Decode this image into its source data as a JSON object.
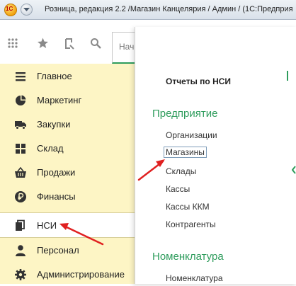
{
  "window": {
    "title": "Розница, редакция 2.2 /Магазин Канцелярия / Админ /  (1С:Предприя"
  },
  "tabs": [
    {
      "label": "Нач"
    }
  ],
  "sidebar": {
    "items": [
      {
        "label": "Главное",
        "icon": "menu-lines-icon"
      },
      {
        "label": "Маркетинг",
        "icon": "pie-chart-icon"
      },
      {
        "label": "Закупки",
        "icon": "truck-icon"
      },
      {
        "label": "Склад",
        "icon": "warehouse-grid-icon"
      },
      {
        "label": "Продажи",
        "icon": "basket-icon"
      },
      {
        "label": "Финансы",
        "icon": "ruble-coin-icon"
      },
      {
        "label": "НСИ",
        "icon": "documents-icon",
        "active": true
      },
      {
        "label": "Персонал",
        "icon": "person-icon"
      },
      {
        "label": "Администрирование",
        "icon": "gear-icon"
      }
    ]
  },
  "panel": {
    "reports_heading": "Отчеты по НСИ",
    "section1": {
      "title": "Предприятие",
      "links": [
        "Организации",
        "Магазины",
        "Склады",
        "Кассы",
        "Кассы ККМ",
        "Контрагенты"
      ]
    },
    "section2": {
      "title": "Номенклатура",
      "links": [
        "Номенклатура"
      ]
    }
  },
  "colors": {
    "accent_green": "#2e9c5c",
    "panel_yellow": "#fdf5c5",
    "arrow_red": "#e02020"
  }
}
